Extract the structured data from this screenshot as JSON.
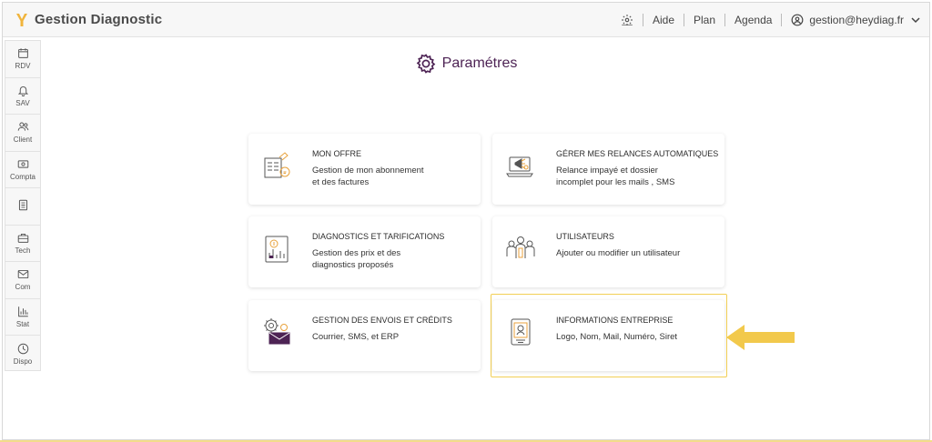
{
  "app": {
    "title": "Gestion Diagnostic"
  },
  "header": {
    "links": [
      "Aide",
      "Plan",
      "Agenda"
    ],
    "user_email": "gestion@heydiag.fr"
  },
  "sidebar": {
    "items": [
      {
        "label": "RDV",
        "icon": "calendar-icon"
      },
      {
        "label": "SAV",
        "icon": "bell-icon"
      },
      {
        "label": "Client",
        "icon": "users-icon"
      },
      {
        "label": "Compta",
        "icon": "cash-icon"
      },
      {
        "label": "",
        "icon": "document-icon"
      },
      {
        "label": "Tech",
        "icon": "briefcase-icon"
      },
      {
        "label": "Com",
        "icon": "mail-icon"
      },
      {
        "label": "Stat",
        "icon": "bar-chart-icon"
      },
      {
        "label": "Dispo",
        "icon": "clock-icon"
      }
    ]
  },
  "page": {
    "title": "Paramétres"
  },
  "cards": [
    {
      "title": "MON OFFRE",
      "desc1": "Gestion de mon abonnement",
      "desc2": "et des factures",
      "icon": "invoice-icon"
    },
    {
      "title": "GÉRER MES RELANCES AUTOMATIQUES",
      "desc1": "Relance impayé et dossier",
      "desc2": "incomplet pour les mails , SMS",
      "icon": "megaphone-laptop-icon"
    },
    {
      "title": "DIAGNOSTICS ET TARIFICATIONS",
      "desc1": "Gestion des prix et des",
      "desc2": "diagnostics proposés",
      "icon": "pricing-chart-icon"
    },
    {
      "title": "UTILISATEURS",
      "desc1": "Ajouter ou modifier un utilisateur",
      "desc2": "",
      "icon": "team-icon"
    },
    {
      "title": "GESTION DES ENVOIS ET CRÉDITS",
      "desc1": "Courrier, SMS, et ERP",
      "desc2": "",
      "icon": "gear-mail-icon"
    },
    {
      "title": "INFORMATIONS ENTREPRISE",
      "desc1": "Logo, Nom, Mail, Numéro, Siret",
      "desc2": "",
      "icon": "id-card-icon"
    }
  ],
  "colors": {
    "accent": "#4d2354",
    "highlight": "#f2c94c",
    "icon_orange": "#e8a23c"
  }
}
